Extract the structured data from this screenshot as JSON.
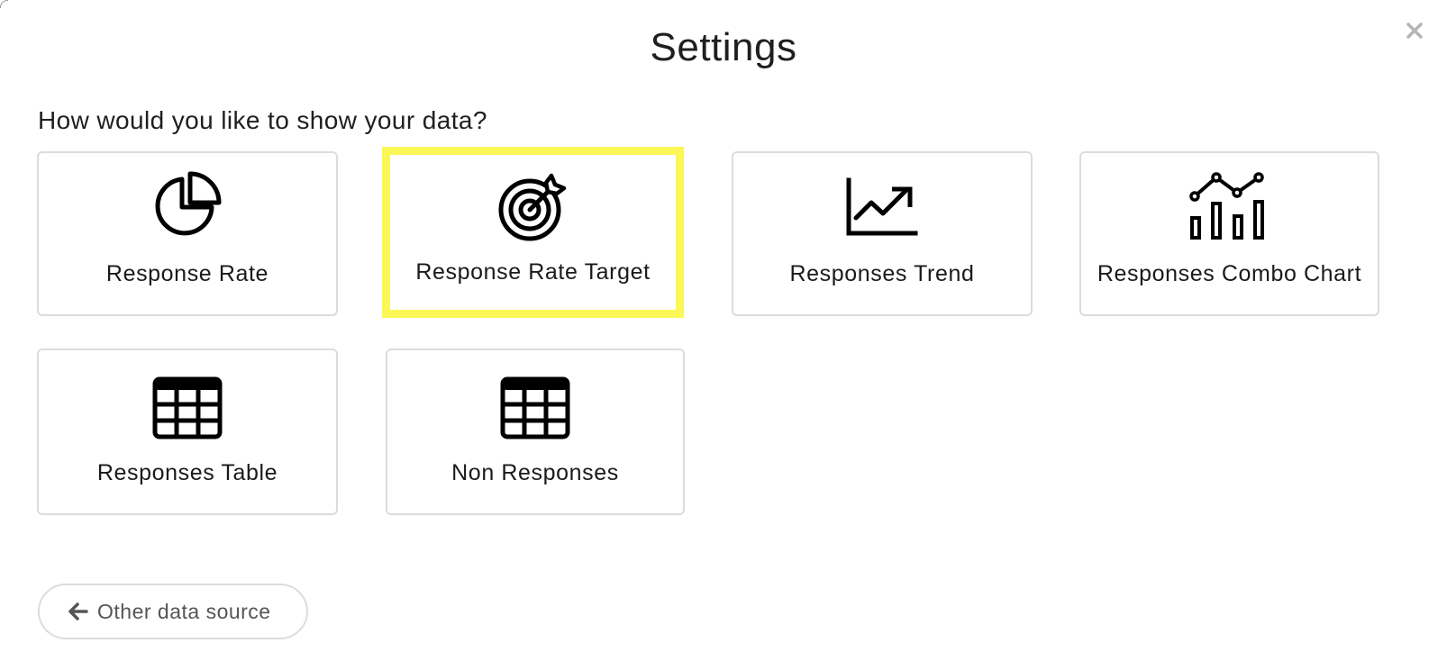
{
  "dialog": {
    "title": "Settings",
    "close_icon": "close-icon"
  },
  "prompt": "How would you like to show your data?",
  "options": [
    {
      "label": "Response Rate",
      "icon": "pie-chart-icon",
      "selected": false
    },
    {
      "label": "Response Rate Target",
      "icon": "target-icon",
      "selected": true
    },
    {
      "label": "Responses Trend",
      "icon": "trend-chart-icon",
      "selected": false
    },
    {
      "label": "Responses Combo Chart",
      "icon": "combo-chart-icon",
      "selected": false
    },
    {
      "label": "Responses Table",
      "icon": "table-icon",
      "selected": false
    },
    {
      "label": "Non Responses",
      "icon": "table-icon",
      "selected": false
    }
  ],
  "back_button": {
    "label": "Other data source",
    "icon": "arrow-left-icon"
  },
  "colors": {
    "highlight": "#fbf756",
    "card_border": "#dcdcdc",
    "text": "#1f1f1f",
    "muted_text": "#555555"
  }
}
